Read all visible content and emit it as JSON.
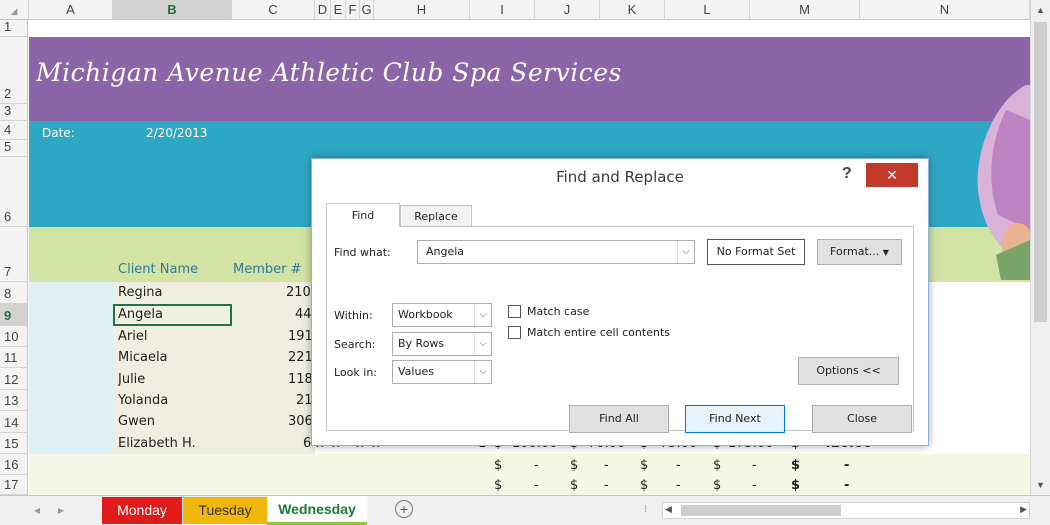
{
  "columns": [
    "A",
    "B",
    "C",
    "D",
    "E",
    "F",
    "G",
    "H",
    "I",
    "J",
    "K",
    "L",
    "M",
    "N"
  ],
  "rows": [
    "1",
    "2",
    "3",
    "4",
    "5",
    "6",
    "7",
    "8",
    "9",
    "10",
    "11",
    "12",
    "13",
    "14",
    "15",
    "16",
    "17"
  ],
  "sheet": {
    "title": "Michigan Avenue Athletic Club Spa Services",
    "date_label": "Date:",
    "date_value": "2/20/2013",
    "header_client": "Client Name",
    "header_member": "Member #",
    "clients": [
      {
        "name": "Regina",
        "member": "210"
      },
      {
        "name": "Angela",
        "member": "44"
      },
      {
        "name": "Ariel",
        "member": "191"
      },
      {
        "name": "Micaela",
        "member": "221"
      },
      {
        "name": "Julie",
        "member": "118"
      },
      {
        "name": "Yolanda",
        "member": "21"
      },
      {
        "name": "Gwen",
        "member": "306"
      },
      {
        "name": "Elizabeth H.",
        "member": "6"
      }
    ],
    "row15": {
      "marks": "x  x    x  x",
      "qty": "1",
      "i": "100.00",
      "j": "70.00",
      "k": "75.00",
      "l": "175.00",
      "m": "420.00"
    },
    "dollar": "$",
    "dash": "-"
  },
  "dialog": {
    "title": "Find and Replace",
    "help": "?",
    "close": "×",
    "tab_find": "Find",
    "tab_replace": "Replace",
    "find_what_label": "Find what:",
    "find_what_value": "Angela",
    "no_format": "No Format Set",
    "format_btn": "Format...",
    "within_label": "Within:",
    "within_value": "Workbook",
    "search_label": "Search:",
    "search_value": "By Rows",
    "lookin_label": "Look in:",
    "lookin_value": "Values",
    "match_case": "Match case",
    "match_entire": "Match entire cell contents",
    "options_btn": "Options <<",
    "find_all": "Find All",
    "find_next": "Find Next",
    "close_btn": "Close"
  },
  "tabs": {
    "prev": "◂",
    "next": "▸",
    "monday": "Monday",
    "tuesday": "Tuesday",
    "wednesday": "Wednesday",
    "add": "+"
  },
  "colors": {
    "purple": "#8c65a8",
    "teal": "#2ea7c4",
    "green_band": "#d3e3a4",
    "beige": "#efeee0",
    "monday": "#e11a1a",
    "tuesday": "#f2b70b",
    "close_red": "#c0392b"
  }
}
